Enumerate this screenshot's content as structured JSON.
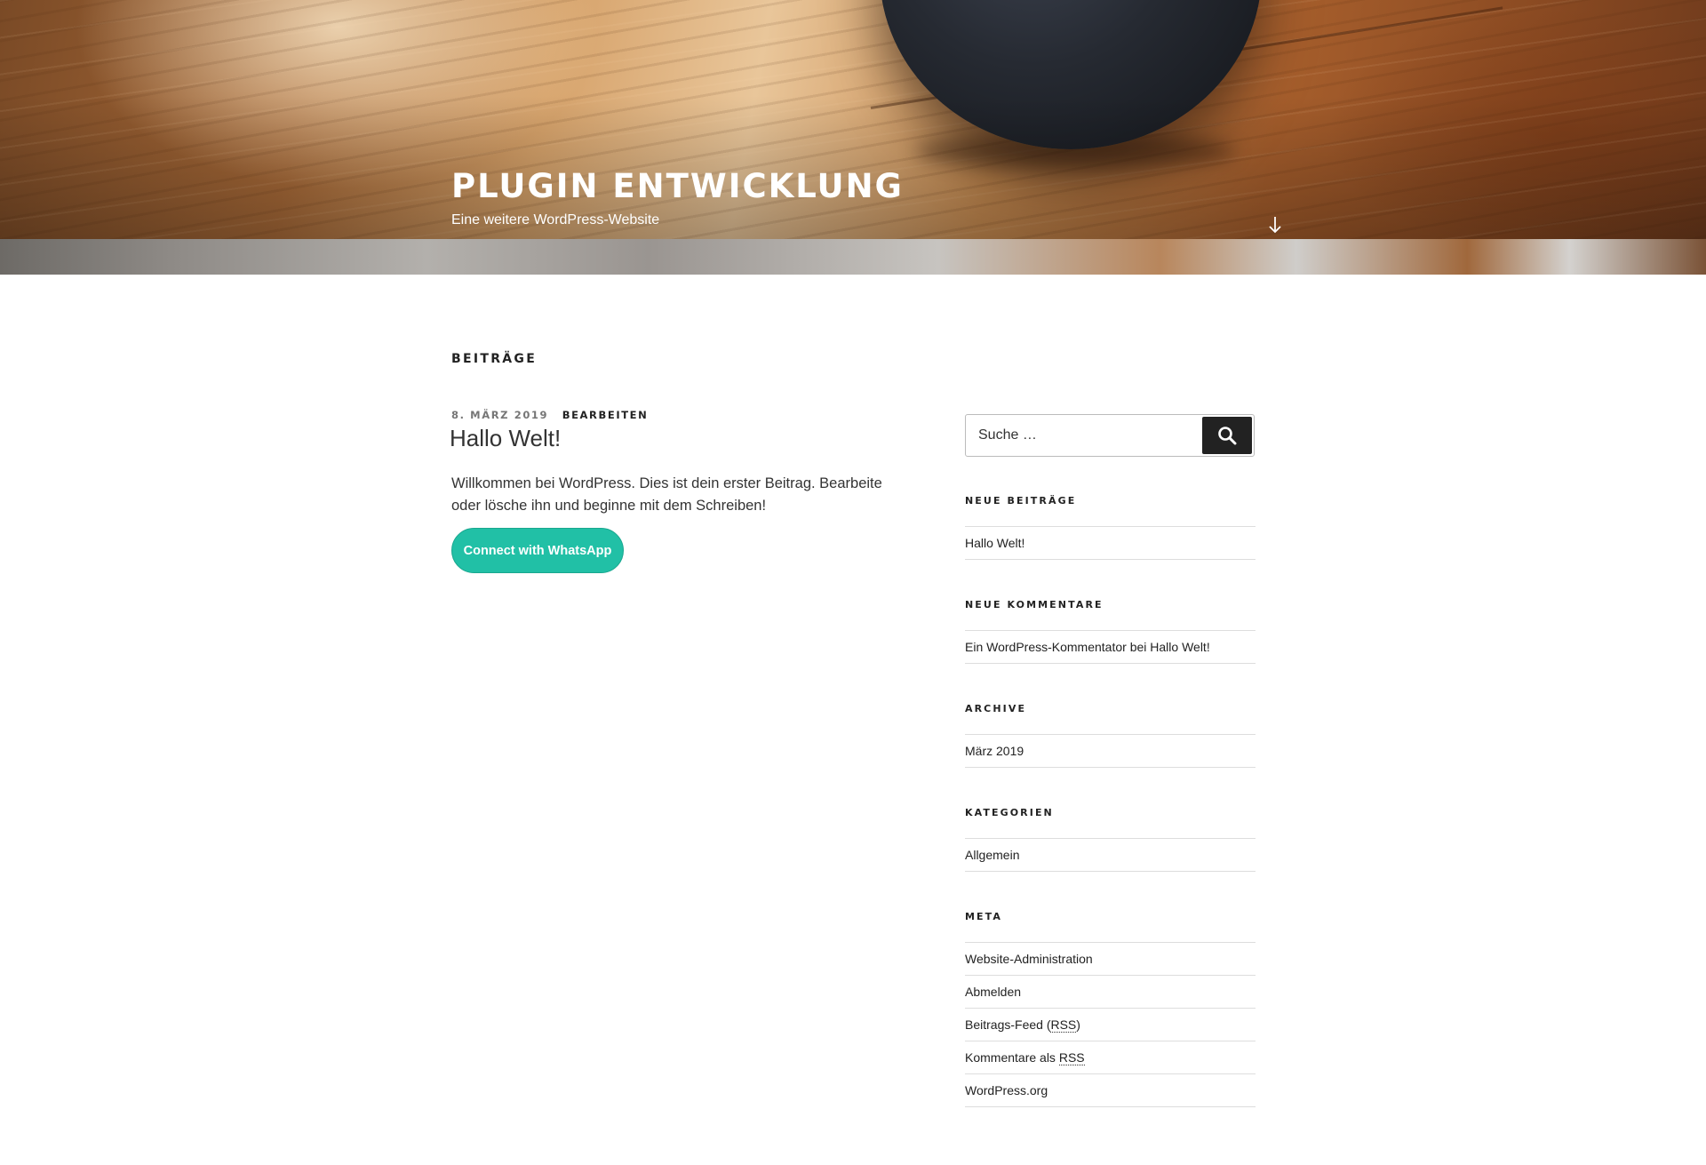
{
  "header": {
    "site_title": "PLUGIN ENTWICKLUNG",
    "site_description": "Eine weitere WordPress-Website",
    "scroll_icon": "arrow-down-icon"
  },
  "main": {
    "page_title": "BEITRÄGE",
    "post": {
      "date": "8. MÄRZ 2019",
      "edit_label": "BEARBEITEN",
      "title": "Hallo Welt!",
      "content": "Willkommen bei WordPress. Dies ist dein erster Beitrag. Bearbeite oder lösche ihn und beginne mit dem Schreiben!",
      "whatsapp_button_label": "Connect with WhatsApp"
    }
  },
  "sidebar": {
    "search": {
      "placeholder": "Suche …",
      "submit_icon": "search-icon"
    },
    "recent_posts": {
      "title": "NEUE BEITRÄGE",
      "items": [
        "Hallo Welt!"
      ]
    },
    "recent_comments": {
      "title": "NEUE KOMMENTARE",
      "author": "Ein WordPress-Kommentator",
      "connector": "bei",
      "post": "Hallo Welt!"
    },
    "archive": {
      "title": "ARCHIVE",
      "items": [
        "März 2019"
      ]
    },
    "categories": {
      "title": "KATEGORIEN",
      "items": [
        "Allgemein"
      ]
    },
    "meta": {
      "title": "META",
      "admin": "Website-Administration",
      "logout": "Abmelden",
      "posts_feed_prefix": "Beitrags-Feed (",
      "posts_feed_abbr": "RSS",
      "posts_feed_suffix": ")",
      "comments_feed_prefix": "Kommentare als ",
      "comments_feed_abbr": "RSS",
      "wordpress_org": "WordPress.org"
    }
  },
  "colors": {
    "accent_button": "#21c0a6",
    "search_button": "#222222",
    "text": "#222222",
    "meta_text": "#767676",
    "divider": "#dddddd"
  }
}
